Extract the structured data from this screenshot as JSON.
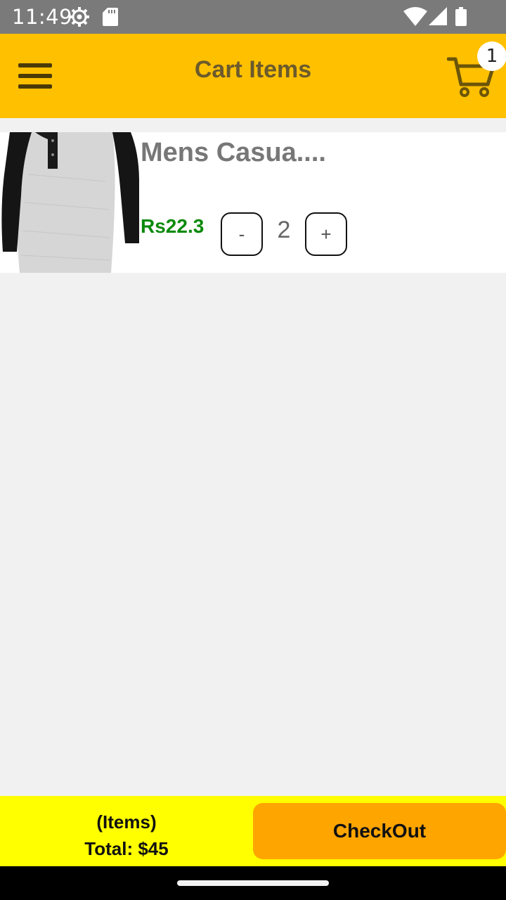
{
  "status_bar": {
    "time": "11:49",
    "icons": [
      "gear-icon",
      "sd-card-icon",
      "wifi-icon",
      "signal-icon",
      "battery-icon"
    ]
  },
  "app_bar": {
    "title": "Cart Items",
    "menu_icon": "hamburger-menu-icon",
    "cart_icon": "shopping-cart-icon",
    "cart_badge_count": "1",
    "background_color": "#ffc000"
  },
  "cart": {
    "items": [
      {
        "name": "Mens Casua....",
        "price": "Rs22.3",
        "quantity": "2",
        "decrement_label": "-",
        "increment_label": "+",
        "image": "raglan-henley-shirt"
      }
    ]
  },
  "footer": {
    "items_label": "(Items)",
    "total_label": "Total: $45",
    "checkout_label": "CheckOut",
    "bar_color": "#ffff00",
    "button_color": "#ffa500"
  },
  "colors": {
    "price_green": "#0b8a0b",
    "title_text": "#6b5a2c"
  }
}
